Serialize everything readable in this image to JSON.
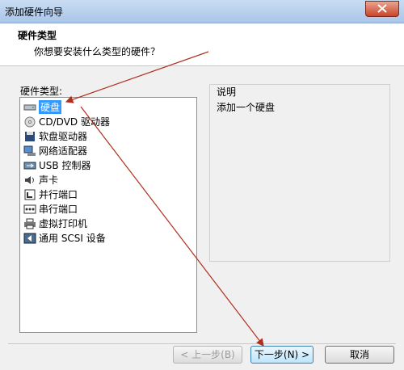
{
  "window": {
    "title": "添加硬件向导"
  },
  "header": {
    "title": "硬件类型",
    "subtitle": "你想要安装什么类型的硬件？"
  },
  "types": {
    "label": "硬件类型:",
    "items": [
      {
        "label": "硬盘",
        "icon": "hard-disk-icon",
        "selected": true
      },
      {
        "label": "CD/DVD 驱动器",
        "icon": "cd-dvd-icon"
      },
      {
        "label": "软盘驱动器",
        "icon": "floppy-icon"
      },
      {
        "label": "网络适配器",
        "icon": "network-adapter-icon"
      },
      {
        "label": "USB 控制器",
        "icon": "usb-icon"
      },
      {
        "label": "声卡",
        "icon": "sound-card-icon"
      },
      {
        "label": "并行端口",
        "icon": "parallel-port-icon"
      },
      {
        "label": "串行端口",
        "icon": "serial-port-icon"
      },
      {
        "label": "虚拟打印机",
        "icon": "printer-icon"
      },
      {
        "label": "通用 SCSI 设备",
        "icon": "scsi-device-icon"
      }
    ]
  },
  "description": {
    "label": "说明",
    "text": "添加一个硬盘"
  },
  "buttons": {
    "back": "< 上一步(B)",
    "next": "下一步(N) >",
    "cancel": "取消"
  },
  "colors": {
    "selection": "#3399ff",
    "annotation_arrow": "#b03020"
  }
}
